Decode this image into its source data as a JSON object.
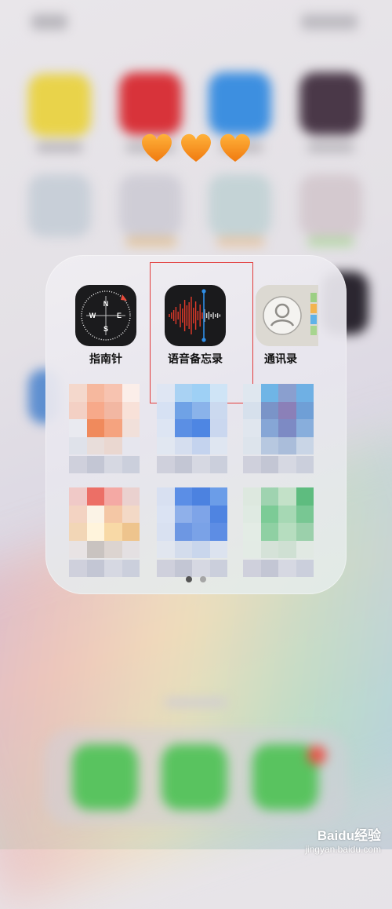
{
  "folder": {
    "apps": [
      {
        "label": "指南针"
      },
      {
        "label": "语音备忘录"
      },
      {
        "label": "通讯录"
      }
    ],
    "page_indicator": {
      "total": 2,
      "current": 1
    }
  },
  "watermark": {
    "brand": "Baidu经验",
    "url": "jingyan.baidu.com"
  },
  "colors": {
    "highlight_box": "#e23b3b",
    "voice_wave": "#e33a2a",
    "playhead": "#2f8ee6"
  }
}
